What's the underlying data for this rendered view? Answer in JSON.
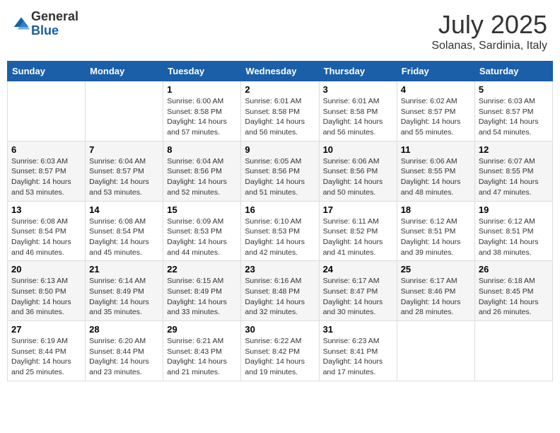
{
  "header": {
    "logo_general": "General",
    "logo_blue": "Blue",
    "month_year": "July 2025",
    "location": "Solanas, Sardinia, Italy"
  },
  "weekdays": [
    "Sunday",
    "Monday",
    "Tuesday",
    "Wednesday",
    "Thursday",
    "Friday",
    "Saturday"
  ],
  "weeks": [
    [
      {
        "day": "",
        "info": ""
      },
      {
        "day": "",
        "info": ""
      },
      {
        "day": "1",
        "info": "Sunrise: 6:00 AM\nSunset: 8:58 PM\nDaylight: 14 hours and 57 minutes."
      },
      {
        "day": "2",
        "info": "Sunrise: 6:01 AM\nSunset: 8:58 PM\nDaylight: 14 hours and 56 minutes."
      },
      {
        "day": "3",
        "info": "Sunrise: 6:01 AM\nSunset: 8:58 PM\nDaylight: 14 hours and 56 minutes."
      },
      {
        "day": "4",
        "info": "Sunrise: 6:02 AM\nSunset: 8:57 PM\nDaylight: 14 hours and 55 minutes."
      },
      {
        "day": "5",
        "info": "Sunrise: 6:03 AM\nSunset: 8:57 PM\nDaylight: 14 hours and 54 minutes."
      }
    ],
    [
      {
        "day": "6",
        "info": "Sunrise: 6:03 AM\nSunset: 8:57 PM\nDaylight: 14 hours and 53 minutes."
      },
      {
        "day": "7",
        "info": "Sunrise: 6:04 AM\nSunset: 8:57 PM\nDaylight: 14 hours and 53 minutes."
      },
      {
        "day": "8",
        "info": "Sunrise: 6:04 AM\nSunset: 8:56 PM\nDaylight: 14 hours and 52 minutes."
      },
      {
        "day": "9",
        "info": "Sunrise: 6:05 AM\nSunset: 8:56 PM\nDaylight: 14 hours and 51 minutes."
      },
      {
        "day": "10",
        "info": "Sunrise: 6:06 AM\nSunset: 8:56 PM\nDaylight: 14 hours and 50 minutes."
      },
      {
        "day": "11",
        "info": "Sunrise: 6:06 AM\nSunset: 8:55 PM\nDaylight: 14 hours and 48 minutes."
      },
      {
        "day": "12",
        "info": "Sunrise: 6:07 AM\nSunset: 8:55 PM\nDaylight: 14 hours and 47 minutes."
      }
    ],
    [
      {
        "day": "13",
        "info": "Sunrise: 6:08 AM\nSunset: 8:54 PM\nDaylight: 14 hours and 46 minutes."
      },
      {
        "day": "14",
        "info": "Sunrise: 6:08 AM\nSunset: 8:54 PM\nDaylight: 14 hours and 45 minutes."
      },
      {
        "day": "15",
        "info": "Sunrise: 6:09 AM\nSunset: 8:53 PM\nDaylight: 14 hours and 44 minutes."
      },
      {
        "day": "16",
        "info": "Sunrise: 6:10 AM\nSunset: 8:53 PM\nDaylight: 14 hours and 42 minutes."
      },
      {
        "day": "17",
        "info": "Sunrise: 6:11 AM\nSunset: 8:52 PM\nDaylight: 14 hours and 41 minutes."
      },
      {
        "day": "18",
        "info": "Sunrise: 6:12 AM\nSunset: 8:51 PM\nDaylight: 14 hours and 39 minutes."
      },
      {
        "day": "19",
        "info": "Sunrise: 6:12 AM\nSunset: 8:51 PM\nDaylight: 14 hours and 38 minutes."
      }
    ],
    [
      {
        "day": "20",
        "info": "Sunrise: 6:13 AM\nSunset: 8:50 PM\nDaylight: 14 hours and 36 minutes."
      },
      {
        "day": "21",
        "info": "Sunrise: 6:14 AM\nSunset: 8:49 PM\nDaylight: 14 hours and 35 minutes."
      },
      {
        "day": "22",
        "info": "Sunrise: 6:15 AM\nSunset: 8:49 PM\nDaylight: 14 hours and 33 minutes."
      },
      {
        "day": "23",
        "info": "Sunrise: 6:16 AM\nSunset: 8:48 PM\nDaylight: 14 hours and 32 minutes."
      },
      {
        "day": "24",
        "info": "Sunrise: 6:17 AM\nSunset: 8:47 PM\nDaylight: 14 hours and 30 minutes."
      },
      {
        "day": "25",
        "info": "Sunrise: 6:17 AM\nSunset: 8:46 PM\nDaylight: 14 hours and 28 minutes."
      },
      {
        "day": "26",
        "info": "Sunrise: 6:18 AM\nSunset: 8:45 PM\nDaylight: 14 hours and 26 minutes."
      }
    ],
    [
      {
        "day": "27",
        "info": "Sunrise: 6:19 AM\nSunset: 8:44 PM\nDaylight: 14 hours and 25 minutes."
      },
      {
        "day": "28",
        "info": "Sunrise: 6:20 AM\nSunset: 8:44 PM\nDaylight: 14 hours and 23 minutes."
      },
      {
        "day": "29",
        "info": "Sunrise: 6:21 AM\nSunset: 8:43 PM\nDaylight: 14 hours and 21 minutes."
      },
      {
        "day": "30",
        "info": "Sunrise: 6:22 AM\nSunset: 8:42 PM\nDaylight: 14 hours and 19 minutes."
      },
      {
        "day": "31",
        "info": "Sunrise: 6:23 AM\nSunset: 8:41 PM\nDaylight: 14 hours and 17 minutes."
      },
      {
        "day": "",
        "info": ""
      },
      {
        "day": "",
        "info": ""
      }
    ]
  ]
}
